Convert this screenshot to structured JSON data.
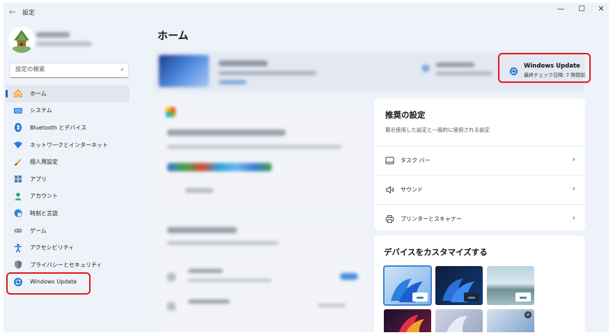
{
  "window": {
    "title": "設定",
    "back": "←",
    "min": "—",
    "max": "☐",
    "close": "✕"
  },
  "sidebar": {
    "search_placeholder": "設定の検索",
    "items": [
      {
        "label": "ホーム",
        "icon": "home-icon"
      },
      {
        "label": "システム",
        "icon": "display-icon"
      },
      {
        "label": "Bluetooth とデバイス",
        "icon": "bluetooth-icon"
      },
      {
        "label": "ネットワークとインターネット",
        "icon": "wifi-icon"
      },
      {
        "label": "個人用設定",
        "icon": "brush-icon"
      },
      {
        "label": "アプリ",
        "icon": "apps-icon"
      },
      {
        "label": "アカウント",
        "icon": "account-icon"
      },
      {
        "label": "時刻と言語",
        "icon": "globe-clock-icon"
      },
      {
        "label": "ゲーム",
        "icon": "gamepad-icon"
      },
      {
        "label": "アクセシビリティ",
        "icon": "accessibility-icon"
      },
      {
        "label": "プライバシーとセキュリティ",
        "icon": "shield-icon"
      },
      {
        "label": "Windows Update",
        "icon": "update-icon"
      }
    ]
  },
  "main": {
    "page_title": "ホーム",
    "windows_update": {
      "title": "Windows Update",
      "subtitle": "最終チェック日時: 7 時間前"
    },
    "recommended": {
      "title": "推奨の設定",
      "subtitle": "最近使用した設定と一般的に使用される設定",
      "items": [
        {
          "label": "タスク バー",
          "icon": "taskbar-icon"
        },
        {
          "label": "サウンド",
          "icon": "speaker-icon"
        },
        {
          "label": "プリンターとスキャナー",
          "icon": "printer-icon"
        }
      ]
    },
    "customize": {
      "title": "デバイスをカスタマイズする"
    }
  },
  "colors": {
    "accent": "#0067c0",
    "highlight": "#e2141c",
    "window_bg": "#eef2f9"
  }
}
